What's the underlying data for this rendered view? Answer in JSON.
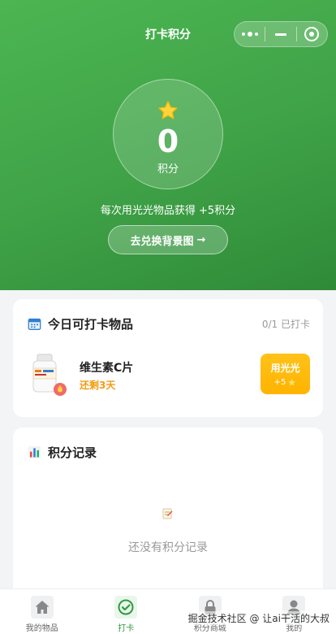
{
  "nav": {
    "title": "打卡积分"
  },
  "points": {
    "value": "0",
    "unit": "积分",
    "rule": "每次用光光物品获得 +5积分",
    "exchange_label": "去兑换背景图",
    "exchange_arrow": "→"
  },
  "today": {
    "title": "今日可打卡物品",
    "status": "0/1 已打卡",
    "items": [
      {
        "name": "维生素C片",
        "remaining": "还剩3天",
        "action_label": "用光光",
        "reward": "+5"
      }
    ]
  },
  "records": {
    "title": "积分记录",
    "empty_text": "还没有积分记录"
  },
  "tabbar": {
    "items": [
      {
        "label": "我的物品",
        "icon": "home-icon"
      },
      {
        "label": "打卡",
        "icon": "check-circle-icon"
      },
      {
        "label": "积分商城",
        "icon": "lock-icon"
      },
      {
        "label": "我的",
        "icon": "user-icon"
      }
    ]
  },
  "watermark": "掘金技术社区 @ 让ai干活的大叔",
  "colors": {
    "primary": "#3fa247",
    "accent": "#ffb300",
    "warning_text": "#f39c12"
  }
}
